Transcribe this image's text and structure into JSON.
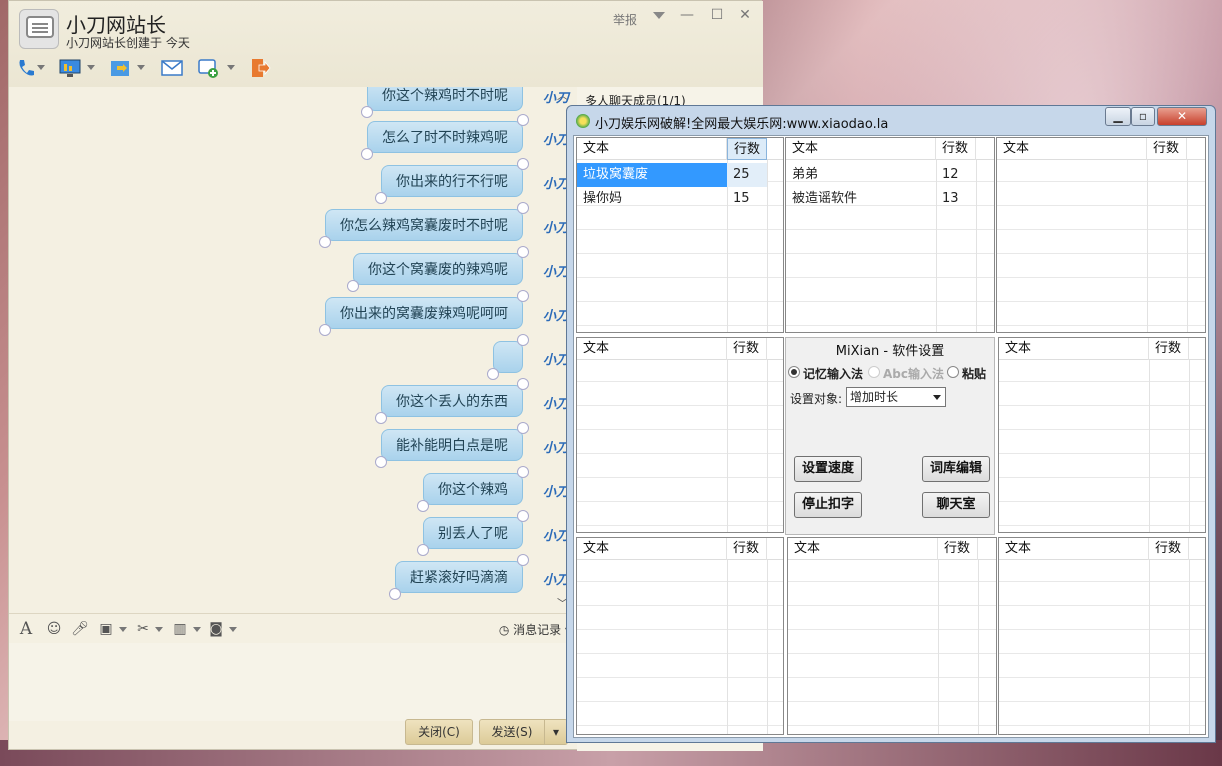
{
  "chat_window": {
    "title": "小刀网站长",
    "subtitle": "小刀网站长创建于 今天",
    "report_label": "举报",
    "minimize": "—",
    "maximize": "☐",
    "close": "✕",
    "toolbar_icons": [
      "phone-icon",
      "screen-share-icon",
      "file-transfer-icon",
      "mail-icon",
      "add-app-icon",
      "exit-icon"
    ],
    "messages": [
      {
        "text": "你这个辣鸡时不时呢",
        "nick": "小刀"
      },
      {
        "text": "怎么了时不时辣鸡呢",
        "nick": "小刀"
      },
      {
        "text": "你出来的行不行呢",
        "nick": "小刀"
      },
      {
        "text": "你怎么辣鸡窝囊废时不时呢",
        "nick": "小刀"
      },
      {
        "text": "你这个窝囊废的辣鸡呢",
        "nick": "小刀"
      },
      {
        "text": "你出来的窝囊废辣鸡呢呵呵",
        "nick": "小刀"
      },
      {
        "text": "",
        "nick": "小刀"
      },
      {
        "text": "你这个丢人的东西",
        "nick": "小刀"
      },
      {
        "text": "能补能明白点是呢",
        "nick": "小刀"
      },
      {
        "text": "你这个辣鸡",
        "nick": "小刀"
      },
      {
        "text": "别丢人了呢",
        "nick": "小刀"
      },
      {
        "text": "赶紧滚好吗滴滴",
        "nick": "小刀"
      }
    ],
    "input_tools": [
      "font-icon",
      "emoji-icon",
      "voice-icon",
      "image-icon",
      "screenshot-icon",
      "chart-icon",
      "more-icon"
    ],
    "message_record": "消息记录",
    "close_button": "关闭(C)",
    "send_button": "发送(S)",
    "members_label": "多人聊天成员(1/1)"
  },
  "tool_window": {
    "title": "小刀娱乐网破解!全网最大娱乐网:www.xiaodao.la",
    "header_text": "文本",
    "header_lines": "行数",
    "grid1_rows": [
      {
        "text": "垃圾窝囊废",
        "lines": "25"
      },
      {
        "text": "操你妈",
        "lines": "15"
      }
    ],
    "grid2_rows": [
      {
        "text": "弟弟",
        "lines": "12"
      },
      {
        "text": "被造谣软件",
        "lines": "13"
      }
    ],
    "settings": {
      "title": "MiXian - 软件设置",
      "radio1": "记忆输入法",
      "radio2": "Abc输入法",
      "radio3": "粘贴",
      "target_label": "设置对象:",
      "target_value": "增加时长",
      "btn_speed": "设置速度",
      "btn_lexicon": "词库编辑",
      "btn_stop": "停止扣字",
      "btn_chatroom": "聊天室"
    }
  }
}
